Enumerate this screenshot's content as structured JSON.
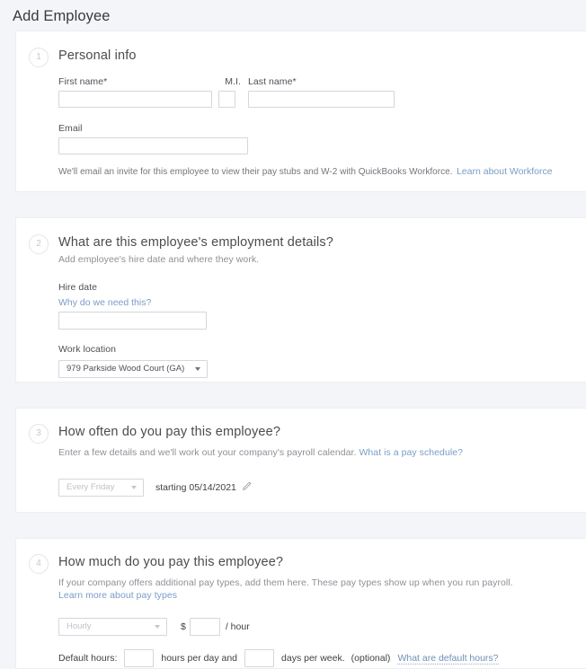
{
  "page": {
    "title": "Add Employee"
  },
  "sections": [
    {
      "number": "1",
      "title": "Personal info",
      "fields": {
        "first_name_label": "First name*",
        "first_name_value": "",
        "mi_label": "M.I.",
        "mi_value": "",
        "last_name_label": "Last name*",
        "last_name_value": "",
        "email_label": "Email",
        "email_value": ""
      },
      "helper_text": "We'll email an invite for this employee to view their pay stubs and W-2 with QuickBooks Workforce.",
      "helper_link": "Learn about Workforce"
    },
    {
      "number": "2",
      "title": "What are this employee's employment details?",
      "subtitle": "Add employee's hire date and where they work.",
      "fields": {
        "hire_date_label": "Hire date",
        "hire_date_link": "Why do we need this?",
        "hire_date_value": "",
        "work_location_label": "Work location",
        "work_location_value": "979 Parkside Wood Court (GA)"
      }
    },
    {
      "number": "3",
      "title": "How often do you pay this employee?",
      "subtitle": "Enter a few details and we'll work out your company's payroll calendar.",
      "subtitle_link": "What is a pay schedule?",
      "fields": {
        "pay_schedule_value": "Every Friday",
        "starting_text": "starting 05/14/2021",
        "edit_icon": "pencil-icon"
      }
    },
    {
      "number": "4",
      "title": "How much do you pay this employee?",
      "subtitle": "If your company offers additional pay types, add them here. These pay types show up when you run payroll.",
      "subtitle_link": "Learn more about pay types",
      "fields": {
        "pay_type_value": "Hourly",
        "currency_symbol": "$",
        "rate_value": "",
        "per_hour_label": "/ hour",
        "default_hours_label": "Default hours:",
        "hours_per_day_value": "",
        "hours_per_day_label": "hours per day and",
        "days_per_week_value": "",
        "days_per_week_label": "days per week.",
        "optional_label": "(optional)",
        "default_hours_link": "What are default hours?"
      }
    }
  ],
  "colors": {
    "page_background": "#f4f5f8",
    "card_background": "#ffffff",
    "text_primary": "#393a3d",
    "text_muted": "#8d9096",
    "link": "#7a9cc6",
    "border": "#d4d7dc"
  }
}
